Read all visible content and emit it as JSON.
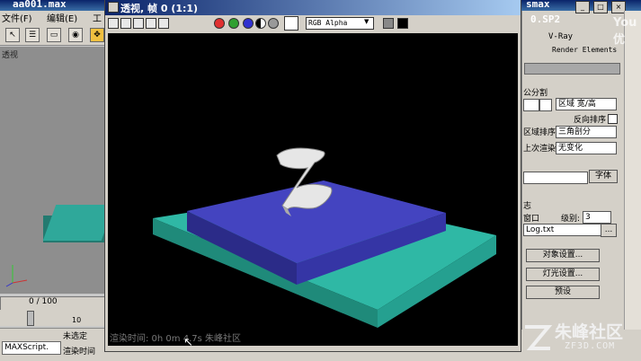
{
  "main_window": {
    "title": "aa001.max",
    "title_right": "smax",
    "menu": [
      "文件(F)",
      "编辑(E)",
      "工"
    ],
    "viewport_label": "透视",
    "timeline": "0 / 100",
    "ruler_marks": [
      "0",
      "10"
    ],
    "maxscript": "MAXScript.",
    "status_unselected": "未选定",
    "status_rendertime": "渲染时间"
  },
  "frame_window": {
    "title": "透视, 帧 0 (1:1)",
    "channel": "RGB Alpha",
    "overlay": "渲染时间: 0h 0m 4.7s 朱峰社区"
  },
  "right_panel": {
    "version": "0.SP2",
    "vray": "V-Ray",
    "render_elements": "Render Elements",
    "split_label": "公分割",
    "region_select": "区域 宽/高",
    "reverse_order": "反向排序",
    "region_order_label": "区域排序",
    "region_order_value": "三角剖分",
    "prev_render_label": "上次渲染",
    "prev_render_value": "无变化",
    "font_btn": "字体",
    "section_label": "志",
    "window_label": "窗口",
    "level_label": "级别:",
    "level_value": "3",
    "log_file": "Log.txt",
    "object_settings": "对象设置...",
    "light_settings": "灯光设置...",
    "preset": "预设"
  },
  "watermark": {
    "side": "You 优",
    "logo": "朱峰社区",
    "logo_sub": "ZF3D.COM"
  },
  "colors": {
    "render_bg": "#000000",
    "title_blue": "#0a246a",
    "teal_base": "#2fb8a5",
    "blue_slab": "#3d3db8",
    "letter": "#e6e6e6"
  }
}
